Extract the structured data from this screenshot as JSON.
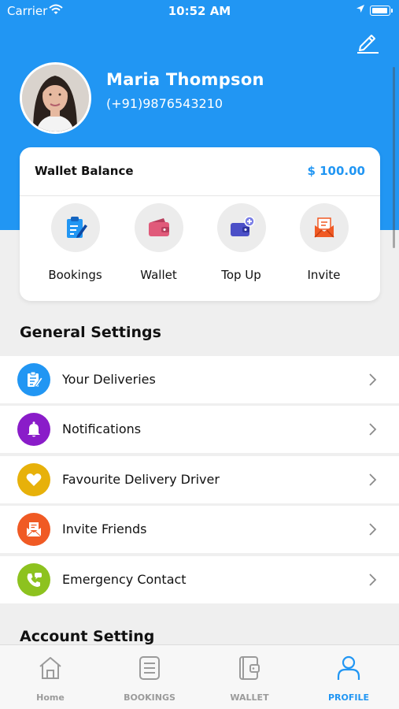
{
  "status_bar": {
    "carrier": "Carrier",
    "time": "10:52 AM"
  },
  "profile": {
    "name": "Maria Thompson",
    "phone": "(+91)9876543210"
  },
  "wallet": {
    "title": "Wallet Balance",
    "amount": "$ 100.00",
    "actions": [
      {
        "label": "Bookings",
        "icon": "clipboard-icon",
        "color": "#2196f3"
      },
      {
        "label": "Wallet",
        "icon": "wallet-icon",
        "color": "#e05a7a"
      },
      {
        "label": "Top Up",
        "icon": "wallet-add-icon",
        "color": "#4b4fc7"
      },
      {
        "label": "Invite",
        "icon": "envelope-icon",
        "color": "#f05a24"
      }
    ]
  },
  "general_settings": {
    "title": "General Settings",
    "items": [
      {
        "label": "Your Deliveries",
        "icon": "clipboard-icon",
        "color": "#2196f3"
      },
      {
        "label": "Notifications",
        "icon": "bell-icon",
        "color": "#8a1cc9"
      },
      {
        "label": "Favourite Delivery Driver",
        "icon": "heart-icon",
        "color": "#e7b10a"
      },
      {
        "label": "Invite Friends",
        "icon": "envelope-icon",
        "color": "#f05a24"
      },
      {
        "label": "Emergency Contact",
        "icon": "phone-icon",
        "color": "#8dc21f"
      }
    ]
  },
  "account_setting": {
    "title": "Account Setting"
  },
  "tabbar": {
    "active_color": "#2196f3",
    "tabs": [
      {
        "label": "Home",
        "icon": "home-icon",
        "active": false
      },
      {
        "label": "BOOKINGS",
        "icon": "bookings-icon",
        "active": false
      },
      {
        "label": "WALLET",
        "icon": "wallet-icon",
        "active": false
      },
      {
        "label": "PROFILE",
        "icon": "profile-icon",
        "active": true
      }
    ]
  }
}
